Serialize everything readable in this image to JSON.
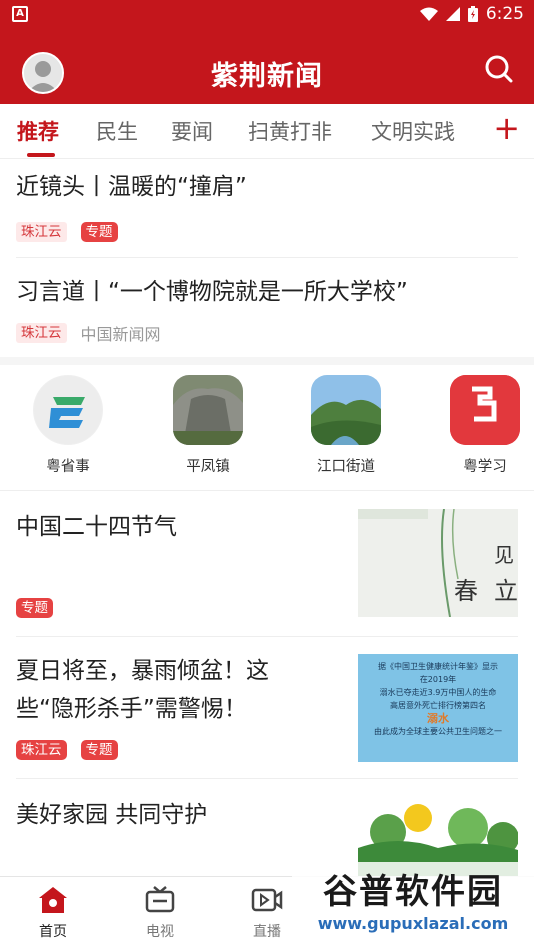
{
  "status_bar": {
    "time": "6:25",
    "left_badge": "A"
  },
  "header": {
    "title": "紫荆新闻"
  },
  "tabs": [
    {
      "label": "推荐",
      "active": true
    },
    {
      "label": "民生"
    },
    {
      "label": "要闻"
    },
    {
      "label": "扫黄打非"
    },
    {
      "label": "文明实践"
    }
  ],
  "top_news": [
    {
      "title": "近镜头丨温暖的“撞肩”",
      "tags": [
        "珠江云",
        "专题"
      ]
    },
    {
      "title": "习言道丨“一个博物院就是一所大学校”",
      "tag": "珠江云",
      "source": "中国新闻网"
    }
  ],
  "shortcuts": [
    {
      "label": "粤省事",
      "icon": "yue-sheng-shi-icon"
    },
    {
      "label": "平凤镇",
      "icon": "ping-feng-zhen-icon"
    },
    {
      "label": "江口街道",
      "icon": "jiang-kou-jie-dao-icon"
    },
    {
      "label": "粤学习",
      "icon": "yue-xue-xi-icon"
    }
  ],
  "feed": [
    {
      "title": "中国二十四节气",
      "tags": [
        "专题"
      ],
      "thumb_text": [
        "见",
        "春",
        "立"
      ]
    },
    {
      "title": "夏日将至，暴雨倾盆！这些“隐形杀手”需警惕！",
      "tags": [
        "珠江云",
        "专题"
      ],
      "thumb_lines": [
        "据《中国卫生健康统计年鉴》显示",
        "在2019年",
        "溺水已夺走近3.9万中国人的生命",
        "高居意外死亡排行榜第四名",
        "溺水",
        "由此成为全球主要公共卫生问题之一"
      ]
    },
    {
      "title": "美好家园 共同守护"
    }
  ],
  "bottom_nav": [
    {
      "label": "首页",
      "icon": "home-icon",
      "active": true
    },
    {
      "label": "电视",
      "icon": "tv-icon"
    },
    {
      "label": "直播",
      "icon": "live-video-icon"
    }
  ],
  "watermark": {
    "line1": "谷普软件园",
    "line2": "www.gupuxlazal.com"
  },
  "colors": {
    "brand_red": "#c4161c",
    "tag_red": "#e64242"
  }
}
